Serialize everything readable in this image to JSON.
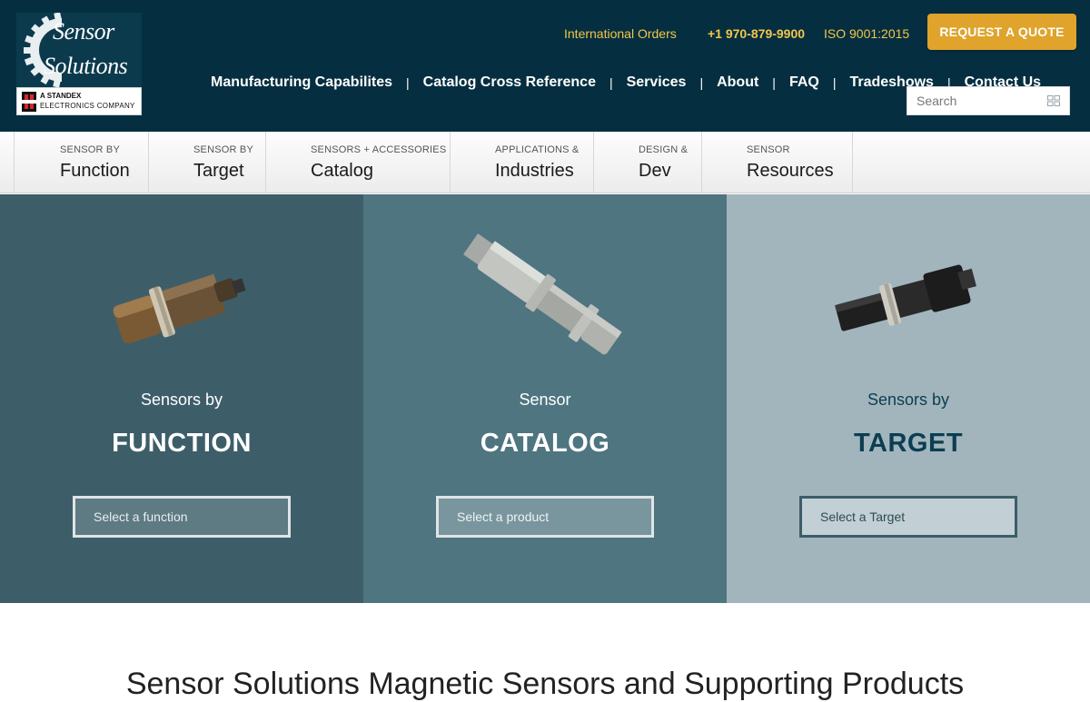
{
  "header": {
    "logo": {
      "line1": "Sensor",
      "line2": "Solutions",
      "standex_line1": "A STANDEX",
      "standex_line2": "ELECTRONICS COMPANY"
    },
    "utility": {
      "international_orders": "International Orders",
      "phone": "+1 970-879-9900",
      "iso": "ISO 9001:2015"
    },
    "quote_button": "REQUEST A QUOTE",
    "nav": [
      "Manufacturing Capabilites",
      "Catalog Cross Reference",
      "Services",
      "About",
      "FAQ",
      "Tradeshows",
      "Contact Us"
    ],
    "nav_separator": "|",
    "search": {
      "placeholder": "Search"
    }
  },
  "categories": [
    {
      "small": "SENSOR BY",
      "big": "Function"
    },
    {
      "small": "SENSOR BY",
      "big": "Target"
    },
    {
      "small": "SENSORS + ACCESSORIES",
      "big": "Catalog"
    },
    {
      "small": "APPLICATIONS &",
      "big": "Industries"
    },
    {
      "small": "DESIGN &",
      "big": "Dev"
    },
    {
      "small": "SENSOR",
      "big": "Resources"
    }
  ],
  "panels": [
    {
      "subtitle": "Sensors by",
      "title": "FUNCTION",
      "select_placeholder": "Select a function"
    },
    {
      "subtitle": "Sensor",
      "title": "CATALOG",
      "select_placeholder": "Select a product"
    },
    {
      "subtitle": "Sensors by",
      "title": "TARGET",
      "select_placeholder": "Select a Target"
    }
  ],
  "bottom_heading": "Sensor Solutions Magnetic Sensors and Supporting Products",
  "colors": {
    "header_bg": "#052f40",
    "accent_gold": "#e0a32b",
    "utility_text": "#f3c64a",
    "panel_function": "#3d5e68",
    "panel_catalog": "#4e7580",
    "panel_target": "#a2b5bd"
  },
  "icons": {
    "search": "search-icon",
    "logo_gear": "gear-icon"
  }
}
